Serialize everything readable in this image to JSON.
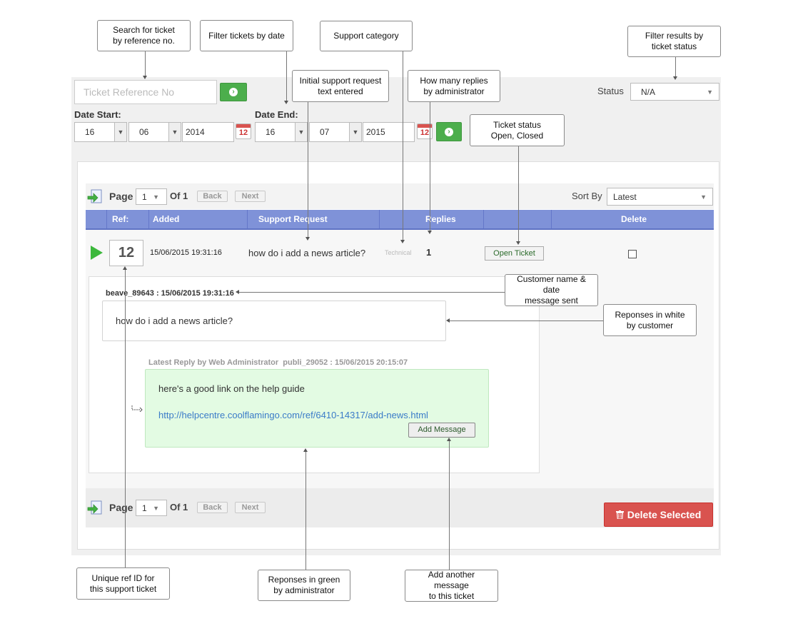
{
  "callouts": {
    "search": "Search for ticket\nby reference no.",
    "filter_date": "Filter tickets by date",
    "support_category": "Support category",
    "filter_status": "Filter results by\nticket status",
    "initial_request": "Initial support request\ntext entered",
    "replies_count": "How many replies\nby administrator",
    "ticket_status": "Ticket status\nOpen, Closed",
    "customer_name": "Customer name & date\nmessage sent",
    "responses_white": "Reponses in white\nby customer",
    "unique_ref": "Unique ref ID for\nthis support ticket",
    "responses_green": "Reponses in green\nby administrator",
    "add_message": "Add another message\nto this ticket"
  },
  "search": {
    "placeholder": "Ticket Reference No"
  },
  "status_filter": {
    "label": "Status",
    "value": "N/A"
  },
  "date_start": {
    "label": "Date Start:",
    "day": "16",
    "month": "06",
    "year": "2014",
    "cal": "12"
  },
  "date_end": {
    "label": "Date End:",
    "day": "16",
    "month": "07",
    "year": "2015",
    "cal": "12"
  },
  "pager": {
    "page_label": "Page",
    "page_value": "1",
    "of_label": "Of 1",
    "back": "Back",
    "next": "Next"
  },
  "sort": {
    "label": "Sort By",
    "value": "Latest"
  },
  "table": {
    "headers": {
      "ref": "Ref:",
      "added": "Added",
      "request": "Support Request",
      "replies": "Replies",
      "delete": "Delete"
    }
  },
  "ticket": {
    "ref": "12",
    "added": "15/06/2015 19:31:16",
    "request": "how do i add a news article?",
    "category": "Technical",
    "replies": "1",
    "action": "Open Ticket"
  },
  "thread": {
    "customer_header": "beave_89643 : 15/06/2015 19:31:16",
    "customer_msg": "how do i add a news article?",
    "admin_header": "Latest Reply by Web Administrator  publi_29052 : 15/06/2015 20:15:07",
    "admin_msg": "here's a good link on the help guide",
    "admin_link": "http://helpcentre.coolflamingo.com/ref/6410-14317/add-news.html",
    "add_message": "Add Message"
  },
  "footer": {
    "delete_selected": "Delete Selected"
  },
  "colors": {
    "green": "#4cae4c",
    "header_blue": "#7f92d8",
    "delete_red": "#d9534f",
    "admin_bg": "#e3fbe3"
  }
}
